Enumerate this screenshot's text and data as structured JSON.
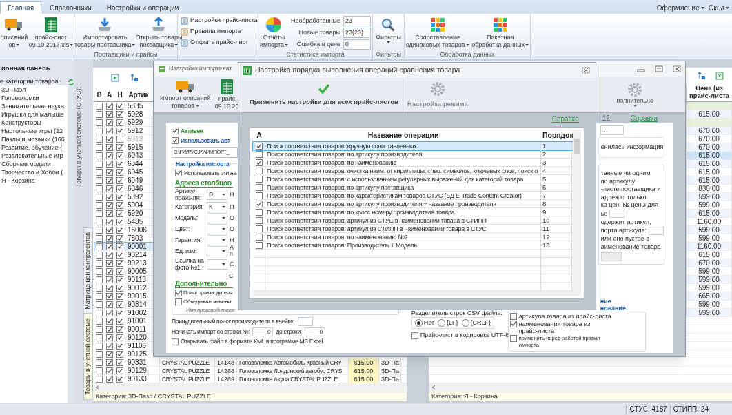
{
  "ribbon": {
    "tabs": [
      {
        "label": "Главная",
        "selected": true
      },
      {
        "label": "Справочники",
        "selected": false
      },
      {
        "label": "Настройки и операции",
        "selected": false
      }
    ],
    "menus": [
      {
        "label": "Оформление"
      },
      {
        "label": "Окна"
      }
    ],
    "groups": [
      {
        "buttons": [
          {
            "lines": [
              "описаний",
              "ов"
            ],
            "dropdown": true
          },
          {
            "lines": [
              "прайс-лист",
              "09.10.2017.xls"
            ],
            "dropdown": true
          }
        ]
      },
      {
        "label": "Поставщики и прайсы",
        "buttons": [
          {
            "lines": [
              "Импортировать",
              "товары поставщика"
            ],
            "dropdown": true
          },
          {
            "lines": [
              "Открыть товары",
              "поставщика"
            ],
            "dropdown": true
          }
        ]
      },
      {
        "links": [
          "Настройки прайс-листа",
          "Правила импорта",
          "Открыть прайс-лист"
        ]
      },
      {
        "label": "Статистика импорта",
        "buttons": [
          {
            "lines": [
              "Отчёты",
              "импорта"
            ],
            "dropdown": true
          }
        ],
        "stats": [
          {
            "label": "Необработанные",
            "value": "23"
          },
          {
            "label": "Новые товары",
            "value": "23(23)"
          },
          {
            "label": "Ошибка в цене",
            "value": "0"
          }
        ]
      },
      {
        "label": "Фильтры",
        "buttons": [
          {
            "lines": [
              "Фильтры"
            ],
            "dropdown": true
          }
        ]
      },
      {
        "label": "Обработка данных",
        "buttons": [
          {
            "lines": [
              "Сопоставление",
              "одинаковых товаров"
            ],
            "dropdown": true
          },
          {
            "lines": [
              "Пакетная",
              "обработка данных"
            ],
            "dropdown": true
          }
        ]
      }
    ]
  },
  "nav": {
    "title": "ионная панель",
    "tree": [
      {
        "label": "е категории товаров",
        "selected": true,
        "children": [
          {
            "label": "3D-Пазл",
            "selected": false
          },
          {
            "label": "Головоломки",
            "selected": false
          },
          {
            "label": "Занимательная наука",
            "selected": false
          },
          {
            "label": "Игрушки для малыше",
            "selected": false
          },
          {
            "label": "Конструкторы",
            "selected": false
          },
          {
            "label": "Настольные игры (22",
            "selected": false
          },
          {
            "label": "Пазлы и мозаики (166",
            "selected": false
          },
          {
            "label": "Развитие, обучение (",
            "selected": false
          },
          {
            "label": "Развлекательные игр",
            "selected": false
          },
          {
            "label": "Сборные модели",
            "selected": false
          },
          {
            "label": "Творчество и Хобби (",
            "selected": false
          },
          {
            "label": "Я - Корзина",
            "selected": false
          }
        ]
      }
    ]
  },
  "stus_grid": {
    "side_title": "Товары в учетной системе (СТУС):",
    "tabs": [
      {
        "label": "Матрица цен контрагентов",
        "selected": false
      },
      {
        "label": "Товары в учетной системе",
        "selected": true
      }
    ],
    "columns": [
      "В",
      "А",
      "Н",
      "Артик"
    ],
    "rows": [
      {
        "v": false,
        "a": true,
        "n": true,
        "article": "5835",
        "selected": false,
        "disabled": false
      },
      {
        "v": false,
        "a": true,
        "n": true,
        "article": "5928",
        "selected": false,
        "disabled": false
      },
      {
        "v": false,
        "a": true,
        "n": true,
        "article": "5929",
        "selected": false,
        "disabled": false
      },
      {
        "v": false,
        "a": true,
        "n": true,
        "article": "5912",
        "selected": false,
        "disabled": false
      },
      {
        "v": false,
        "a": true,
        "n": false,
        "article": "5913",
        "selected": false,
        "disabled": true
      },
      {
        "v": false,
        "a": true,
        "n": true,
        "article": "5915",
        "selected": false,
        "disabled": false
      },
      {
        "v": false,
        "a": true,
        "n": true,
        "article": "6043",
        "selected": false,
        "disabled": false
      },
      {
        "v": false,
        "a": true,
        "n": true,
        "article": "6044",
        "selected": false,
        "disabled": false
      },
      {
        "v": false,
        "a": true,
        "n": true,
        "article": "6045",
        "selected": false,
        "disabled": false
      },
      {
        "v": false,
        "a": true,
        "n": true,
        "article": "6049",
        "selected": false,
        "disabled": false
      },
      {
        "v": false,
        "a": true,
        "n": true,
        "article": "6046",
        "selected": false,
        "disabled": false
      },
      {
        "v": false,
        "a": true,
        "n": true,
        "article": "5392",
        "selected": false,
        "disabled": false
      },
      {
        "v": false,
        "a": true,
        "n": true,
        "article": "5904",
        "selected": false,
        "disabled": false
      },
      {
        "v": false,
        "a": true,
        "n": true,
        "article": "5920",
        "selected": false,
        "disabled": false
      },
      {
        "v": false,
        "a": true,
        "n": true,
        "article": "5485",
        "selected": false,
        "disabled": false
      },
      {
        "v": false,
        "a": true,
        "n": true,
        "article": "16006",
        "selected": false,
        "disabled": false
      },
      {
        "v": false,
        "a": true,
        "n": true,
        "article": "7803",
        "selected": false,
        "disabled": false
      },
      {
        "v": false,
        "a": true,
        "n": true,
        "article": "90001",
        "selected": true,
        "disabled": false
      },
      {
        "v": false,
        "a": true,
        "n": true,
        "article": "90214",
        "selected": false,
        "disabled": false
      },
      {
        "v": false,
        "a": true,
        "n": true,
        "article": "90213",
        "selected": false,
        "disabled": false
      },
      {
        "v": false,
        "a": true,
        "n": true,
        "article": "90005",
        "selected": false,
        "disabled": false
      },
      {
        "v": false,
        "a": true,
        "n": true,
        "article": "90113",
        "selected": false,
        "disabled": false
      },
      {
        "v": false,
        "a": true,
        "n": true,
        "article": "90012",
        "selected": false,
        "disabled": false
      },
      {
        "v": false,
        "a": true,
        "n": true,
        "article": "90015",
        "selected": false,
        "disabled": false
      },
      {
        "v": false,
        "a": true,
        "n": true,
        "article": "90314",
        "selected": false,
        "disabled": false
      },
      {
        "v": false,
        "a": true,
        "n": true,
        "article": "91002",
        "selected": false,
        "disabled": false
      },
      {
        "v": false,
        "a": true,
        "n": true,
        "article": "91001",
        "selected": false,
        "disabled": false
      },
      {
        "v": false,
        "a": true,
        "n": true,
        "article": "90011",
        "selected": false,
        "disabled": false
      },
      {
        "v": false,
        "a": true,
        "n": true,
        "article": "90120",
        "selected": false,
        "disabled": false
      },
      {
        "v": false,
        "a": true,
        "n": true,
        "article": "91106",
        "selected": false,
        "disabled": false
      },
      {
        "v": false,
        "a": true,
        "n": true,
        "article": "90125",
        "selected": false,
        "disabled": false
      },
      {
        "v": false,
        "a": true,
        "n": true,
        "article": "90331",
        "maker": "CRYSTAL PUZZLE",
        "code": "14148",
        "name": "Головоломка Автомобиль Красный CRY",
        "price": "615.00",
        "category": "3D-Па",
        "selected": false,
        "disabled": false
      },
      {
        "v": false,
        "a": true,
        "n": true,
        "article": "90129",
        "maker": "CRYSTAL PUZZLE",
        "code": "14268",
        "name": "Головоломка Лондонский автобус CRYS",
        "price": "615.00",
        "category": "3D-Па",
        "selected": false,
        "disabled": false
      },
      {
        "v": false,
        "a": true,
        "n": true,
        "article": "90133",
        "maker": "CRYSTAL PUZZLE",
        "code": "14269",
        "name": "Головоломка Акула CRYSTAL PUZZLE",
        "price": "615.00",
        "category": "3D-Па",
        "selected": false,
        "disabled": false
      }
    ],
    "footer": "Категория: 3D-Пазл / CRYSTAL PUZZLE"
  },
  "price_grid": {
    "column": "Цена (из прайс-листа",
    "rows": [
      {
        "kind": "group",
        "selected": false
      },
      {
        "kind": "item",
        "price": "615.00",
        "selected": false
      },
      {
        "kind": "group",
        "selected": false
      },
      {
        "kind": "item",
        "price": "670.00",
        "selected": false
      },
      {
        "kind": "item",
        "price": "670.00",
        "selected": false
      },
      {
        "kind": "item",
        "price": "670.00",
        "selected": false
      },
      {
        "kind": "item",
        "price": "615.00",
        "selected": true
      },
      {
        "kind": "item",
        "price": "615.00",
        "selected": false
      },
      {
        "kind": "item",
        "price": "615.00",
        "selected": false
      },
      {
        "kind": "item",
        "price": "615.00",
        "selected": false
      },
      {
        "kind": "item",
        "price": "830.00",
        "selected": false
      },
      {
        "kind": "item",
        "price": "599.00",
        "selected": false
      },
      {
        "kind": "item",
        "price": "599.00",
        "selected": false
      },
      {
        "kind": "item",
        "price": "615.00",
        "selected": false
      },
      {
        "kind": "item",
        "price": "1160.00",
        "selected": false
      },
      {
        "kind": "item",
        "price": "599.00",
        "selected": false
      },
      {
        "kind": "item",
        "price": "599.00",
        "selected": false
      },
      {
        "kind": "item",
        "price": "1160.00",
        "selected": false
      },
      {
        "kind": "item",
        "price": "615.00",
        "selected": false
      },
      {
        "kind": "item",
        "price": "670.00",
        "selected": false
      },
      {
        "kind": "item",
        "price": "599.00",
        "selected": false
      },
      {
        "kind": "item",
        "price": "599.00",
        "selected": false
      },
      {
        "kind": "item",
        "price": "599.00",
        "selected": false
      },
      {
        "kind": "item",
        "price": "665.00",
        "selected": false
      },
      {
        "kind": "item",
        "price": "599.00",
        "selected": false
      },
      {
        "kind": "item",
        "price": "599.00",
        "selected": false
      }
    ],
    "footer": "Категория: Я - Корзина"
  },
  "import_window": {
    "title": "Настройка импорта кат",
    "toolbar": [
      {
        "lines": [
          "Импорт описаний",
          "товаров"
        ],
        "dropdown": true
      },
      {
        "lines": [
          "прайс",
          "09.10.20"
        ],
        "dropdown": false
      }
    ],
    "toolbar_right": {
      "label": "полнительно",
      "dropdown": true
    },
    "counter": "12",
    "help_link": "Справка",
    "active": {
      "label": "Активен",
      "checked": true
    },
    "auto": {
      "label": "Использовать авт",
      "checked": true
    },
    "path": "C:\\ГУУРУС.РУ\\ИМПОРТ_",
    "settings_title": "Настройка импорта",
    "use_settings": {
      "label": "Использовать эти на",
      "checked": true
    },
    "columns_title": "Адреса столбцов",
    "fields": [
      {
        "label": "Артикул произ-ля:",
        "value": "D",
        "fragment": "Н"
      },
      {
        "label": "Категория:",
        "value": "K",
        "fragment": "П"
      },
      {
        "label": "Модель:",
        "fragment": "О"
      },
      {
        "label": "Цвет:",
        "fragment": "О"
      },
      {
        "label": "Гарантия:",
        "fragment": "Н"
      },
      {
        "label": "Ед. изм:",
        "fragment": "А п"
      },
      {
        "label": "Ссылка на фото №1:",
        "fragment": "С"
      }
    ],
    "fragment_extra": "С",
    "more_title": "Дополнительно",
    "options": [
      {
        "label": "Поиск производителя",
        "checked": true
      },
      {
        "label": "Объединять значени",
        "checked": false
      }
    ],
    "maker_hint": "Имя производителя:",
    "force_search": "Принудительный поиск производителя в ячейке:",
    "start_row": {
      "label": "Начинать импорт со строки №:",
      "value": "0"
    },
    "end_row": {
      "label": "до строки:",
      "value": "0"
    },
    "xml": {
      "label": "Открывать файл в формате XML в программе MS Excel",
      "checked": false
    },
    "csv": {
      "label": "Разделитель строк CSV файла:",
      "options": [
        {
          "label": "Нет",
          "selected": true
        },
        {
          "label": "{LF}",
          "selected": false
        },
        {
          "label": "{CRLF}",
          "selected": false
        }
      ]
    },
    "utf8": {
      "label": "Прайс-лист в кодировке UTF-8",
      "checked": false
    },
    "browse": "...",
    "info_note": "енилась информация",
    "notes": [
      {
        "kind": "line",
        "text": "танные ни одним"
      },
      {
        "kind": "line",
        "text": "по артикулу"
      },
      {
        "kind": "line",
        "text": "-листе поставщика и"
      },
      {
        "kind": "line",
        "text": "адлежат только"
      },
      {
        "kind": "line",
        "text": "ко цен, № цены для"
      },
      {
        "kind": "field",
        "text": "ы:"
      },
      {
        "kind": "line",
        "text": "одержит артикул,"
      },
      {
        "kind": "field",
        "text": "порта артикула:"
      },
      {
        "kind": "line",
        "text": "или оно пустое в"
      },
      {
        "kind": "line",
        "text": "аименование товара"
      }
    ],
    "match_title": [
      "ние",
      "нование:"
    ],
    "match_options": [
      {
        "label": "артикула товара из прайс-листа",
        "checked": false
      },
      {
        "label": "наименования товара из прайс-листа",
        "checked": true
      },
      {
        "label": "применить перед работой правил импорта",
        "checked": false
      }
    ]
  },
  "order_dialog": {
    "title": "Настройка порядка выполнения операций сравнения товара",
    "toolbar": [
      {
        "label": "Применить настройки для всех прайс-листов",
        "disabled": false
      },
      {
        "label": "Настройка режима",
        "disabled": true
      }
    ],
    "help_link": "Справка",
    "columns": [
      "А",
      "Название операции",
      "Порядок"
    ],
    "rows": [
      {
        "checked": true,
        "name": "Поиск соответствия товаров: вручную сопоставленных",
        "order": "1",
        "selected": true
      },
      {
        "checked": false,
        "name": "Поиск соответствия товаров: по артикулу производителя",
        "order": "2",
        "selected": false
      },
      {
        "checked": true,
        "name": "Поиск соответствия товаров: по наименованию",
        "order": "3",
        "selected": false
      },
      {
        "checked": false,
        "name": "Поиск соответствия товаров: очистка наим. от кириллицы, спец. символов, ключевых слов, поиск о",
        "order": "4",
        "selected": false
      },
      {
        "checked": false,
        "name": "Поиск соответствия товаров: с использованием регулярных выражений для категорий товара",
        "order": "5",
        "selected": false
      },
      {
        "checked": false,
        "name": "Поиск соответствия товаров: по артикулу поставщика",
        "order": "6",
        "selected": false
      },
      {
        "checked": false,
        "name": "Поиск соответствия товаров: по характеристикам товаров СТУС (БД E-Trade Content Creator)",
        "order": "7",
        "selected": false
      },
      {
        "checked": true,
        "name": "Поиск соответствия товаров: по артикулу производителя + название производителя",
        "order": "8",
        "selected": false
      },
      {
        "checked": false,
        "name": "Поиск соответствия товаров: по кросс номеру производителя товара",
        "order": "9",
        "selected": false
      },
      {
        "checked": false,
        "name": "Поиск соответствия товаров: артикул из СТУС в наименовании товара в СТИПП",
        "order": "10",
        "selected": false
      },
      {
        "checked": false,
        "name": "Поиск соответствия товаров: артикул из СТИПП в наименовании товара в СТУС",
        "order": "11",
        "selected": false
      },
      {
        "checked": false,
        "name": "Поиск соответствия товаров: по наименованию №2",
        "order": "12",
        "selected": false
      },
      {
        "checked": false,
        "name": "Поиск соответствия товаров: Производитель + Модель",
        "order": "13",
        "selected": false
      }
    ]
  },
  "status": [
    "СТУС: 4187",
    "СТИПП: 24"
  ]
}
